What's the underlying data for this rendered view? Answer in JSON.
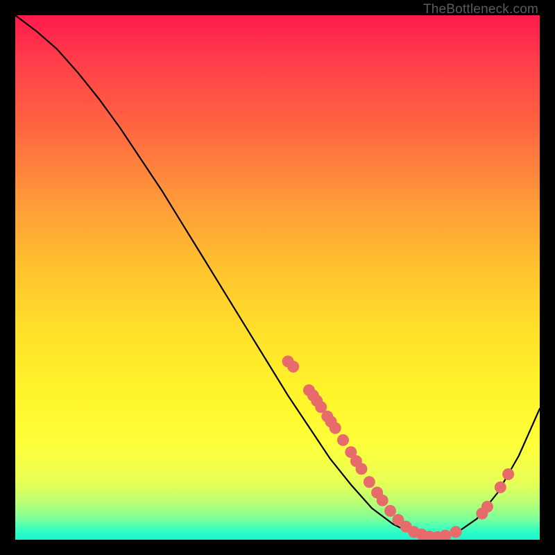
{
  "watermark": "TheBottleneck.com",
  "chart_data": {
    "type": "line",
    "title": "",
    "xlabel": "",
    "ylabel": "",
    "xlim": [
      0,
      100
    ],
    "ylim": [
      0,
      100
    ],
    "series": [
      {
        "name": "curve",
        "x": [
          0,
          4,
          8,
          12,
          16,
          20,
          24,
          28,
          32,
          36,
          40,
          44,
          48,
          52,
          56,
          60,
          64,
          68,
          72,
          76,
          80,
          84,
          88,
          92,
          96,
          100
        ],
        "y": [
          100,
          97,
          93.5,
          89,
          84,
          78.5,
          72.5,
          66.5,
          60,
          53.5,
          47,
          40.5,
          34,
          27.5,
          21.5,
          15.5,
          10.5,
          6,
          3,
          1,
          0.3,
          1.2,
          4,
          9,
          16,
          25
        ]
      }
    ],
    "scatter_points": {
      "name": "markers",
      "color": "#e76b6b",
      "points": [
        {
          "x": 52.0,
          "y": 34.0
        },
        {
          "x": 53.0,
          "y": 33.0
        },
        {
          "x": 56.0,
          "y": 28.5
        },
        {
          "x": 56.8,
          "y": 27.5
        },
        {
          "x": 57.5,
          "y": 26.5
        },
        {
          "x": 58.3,
          "y": 25.3
        },
        {
          "x": 59.5,
          "y": 23.5
        },
        {
          "x": 60.2,
          "y": 22.5
        },
        {
          "x": 61.0,
          "y": 21.3
        },
        {
          "x": 62.5,
          "y": 19.0
        },
        {
          "x": 64.0,
          "y": 16.7
        },
        {
          "x": 65.0,
          "y": 15.0
        },
        {
          "x": 66.0,
          "y": 13.5
        },
        {
          "x": 67.5,
          "y": 11.0
        },
        {
          "x": 69.0,
          "y": 9.0
        },
        {
          "x": 70.0,
          "y": 7.5
        },
        {
          "x": 71.5,
          "y": 5.5
        },
        {
          "x": 73.0,
          "y": 3.8
        },
        {
          "x": 74.5,
          "y": 2.5
        },
        {
          "x": 76.0,
          "y": 1.5
        },
        {
          "x": 77.5,
          "y": 1.0
        },
        {
          "x": 79.0,
          "y": 0.6
        },
        {
          "x": 80.5,
          "y": 0.5
        },
        {
          "x": 82.0,
          "y": 0.8
        },
        {
          "x": 84.0,
          "y": 1.5
        },
        {
          "x": 89.0,
          "y": 5.0
        },
        {
          "x": 90.0,
          "y": 6.3
        },
        {
          "x": 92.5,
          "y": 10.0
        },
        {
          "x": 94.0,
          "y": 12.5
        }
      ]
    }
  }
}
